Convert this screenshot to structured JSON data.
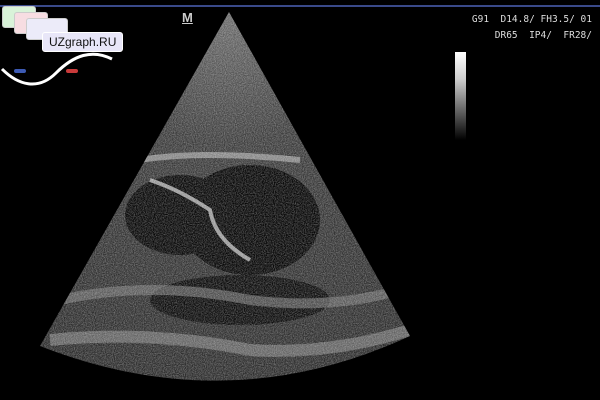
{
  "logo": {
    "text": "UZgraph.RU",
    "colors": {
      "tab1": "#c8f0c8",
      "tab2": "#f6d6dc",
      "tab3": "#e8e6f8",
      "dot_left": "#3d5ab3",
      "dot_right": "#c93a3a"
    }
  },
  "orientation_marker": "M",
  "parameters": {
    "line1": "G91  D14.8/ FH3.5/ 01",
    "line2": "DR65  IP4/  FR28/"
  },
  "grayscale_bar": {
    "icon": "grayscale-bar"
  },
  "image": {
    "icon": "ultrasound-sector-image"
  }
}
